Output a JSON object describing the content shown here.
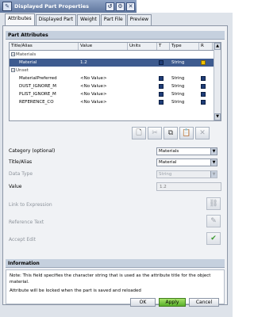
{
  "window": {
    "title": "Displayed Part Properties"
  },
  "tabs": [
    "Attributes",
    "Displayed Part",
    "Weight",
    "Part File",
    "Preview"
  ],
  "part_attributes": {
    "header": "Part Attributes",
    "columns": [
      "Title/Alias",
      "Value",
      "Units",
      "T",
      "Type",
      "R"
    ],
    "rows": [
      {
        "title": "Materials",
        "value": "",
        "units": "",
        "type": "",
        "kind": "group"
      },
      {
        "title": "Material",
        "value": "1.2",
        "units": "",
        "type": "String",
        "kind": "selected"
      },
      {
        "title": "Unset",
        "value": "",
        "units": "",
        "type": "",
        "kind": "group"
      },
      {
        "title": "MaterialPreferred",
        "value": "<No Value>",
        "units": "",
        "type": "String",
        "kind": "child"
      },
      {
        "title": "DUST_IGNORE_M",
        "value": "<No Value>",
        "units": "",
        "type": "String",
        "kind": "child"
      },
      {
        "title": "PLIST_IGNORE_M",
        "value": "<No Value>",
        "units": "",
        "type": "String",
        "kind": "child"
      },
      {
        "title": "REFERENCE_CO",
        "value": "<No Value>",
        "units": "",
        "type": "String",
        "kind": "child"
      }
    ]
  },
  "form": {
    "category_label": "Category (optional)",
    "category_value": "Materials",
    "title_label": "Title/Alias",
    "title_value": "Material",
    "data_type_label": "Data Type",
    "data_type_value": "String",
    "value_label": "Value",
    "value_value": "1.2",
    "link_label": "Link to Expression",
    "reference_label": "Reference Text",
    "accept_label": "Accept Edit"
  },
  "information": {
    "header": "Information",
    "note": "Note: This field specifies the character string that is used as the attribute title for the object material.",
    "line2": "Attribute will be locked when the part is saved and reloaded"
  },
  "buttons": {
    "ok": "OK",
    "apply": "Apply",
    "cancel": "Cancel"
  },
  "colors": {
    "selected_row": "#3e5b8f",
    "group_header": "#c5d0de",
    "apply": "#58b02a"
  }
}
